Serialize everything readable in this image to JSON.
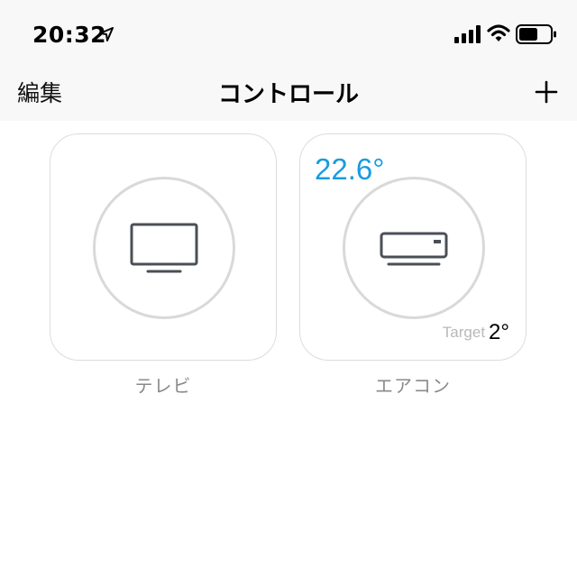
{
  "status_bar": {
    "time": "20:32",
    "icons": [
      "location-arrow-icon",
      "cellular-signal-icon",
      "wifi-icon",
      "battery-icon"
    ]
  },
  "nav": {
    "edit_label": "編集",
    "title": "コントロール",
    "add_icon": "plus-icon"
  },
  "devices": [
    {
      "name": "テレビ",
      "icon": "tv-icon"
    },
    {
      "name": "エアコン",
      "icon": "air-conditioner-icon",
      "current_temperature": "22.6°",
      "target_label": "Target",
      "target_value": "2°"
    }
  ],
  "colors": {
    "accent_temperature": "#1a9be0",
    "icon_gray": "#4a4f57",
    "circle_border": "#d9d9d9",
    "tile_border": "#dcdcdc",
    "header_background": "#f8f8f8"
  }
}
